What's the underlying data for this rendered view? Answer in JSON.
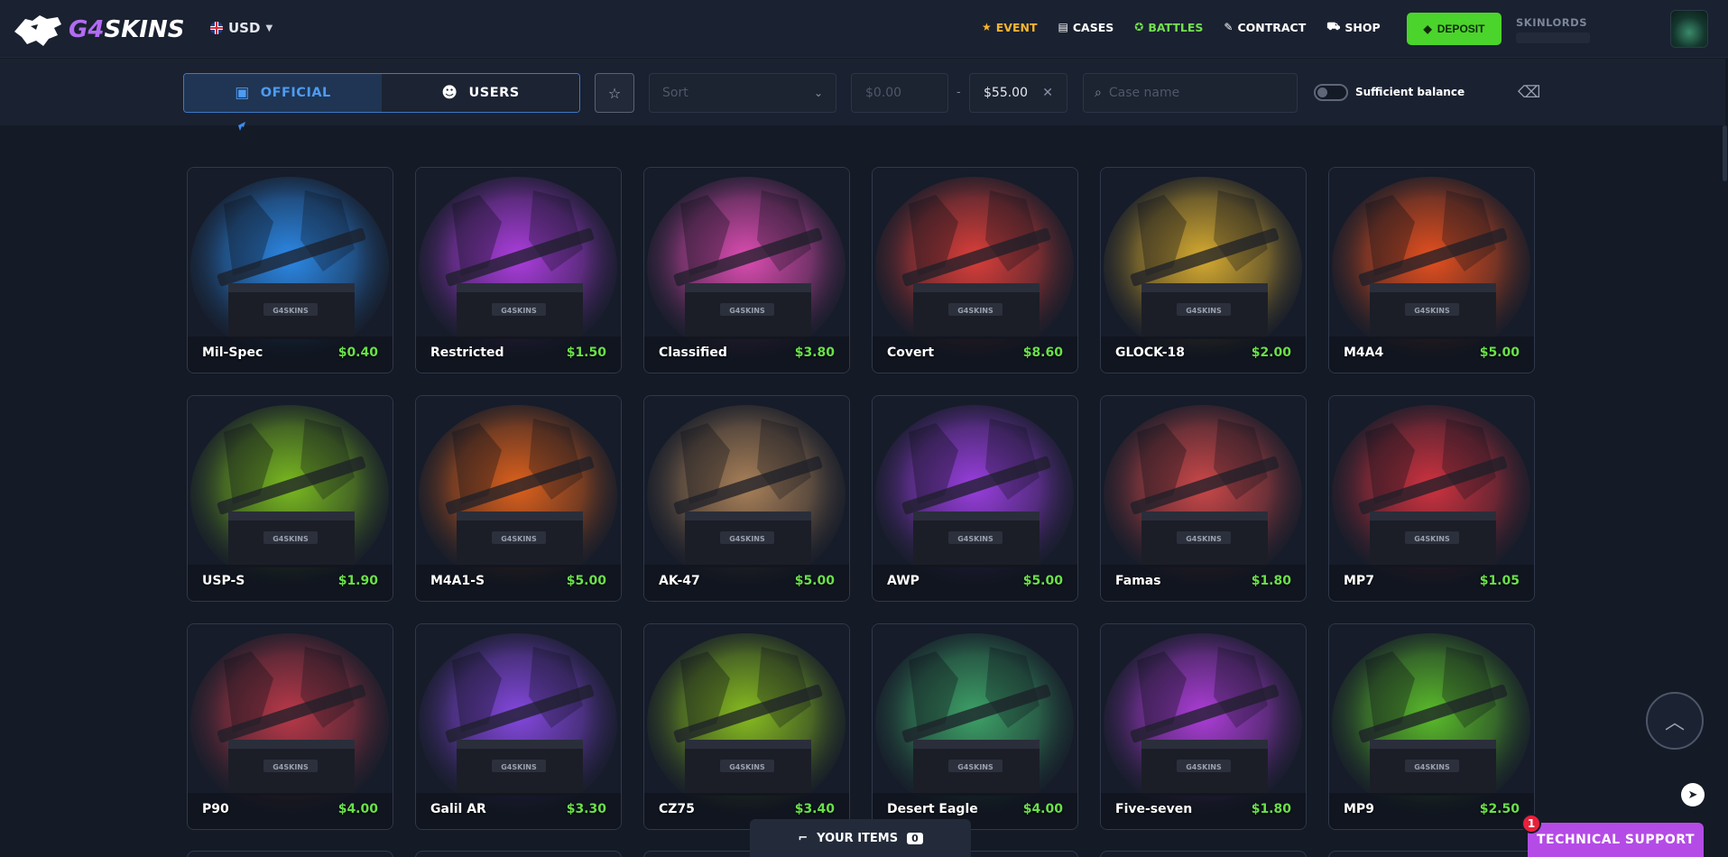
{
  "header": {
    "logo_text_prefix": "G4",
    "logo_text_suffix": "SKINS",
    "currency": "USD",
    "nav": [
      {
        "label": "EVENT",
        "icon": "star-icon",
        "color": "#f5b530"
      },
      {
        "label": "CASES",
        "icon": "cases-icon",
        "color": "#ffffff"
      },
      {
        "label": "BATTLES",
        "icon": "battles-icon",
        "color": "#72e04f"
      },
      {
        "label": "CONTRACT",
        "icon": "pencil-icon",
        "color": "#ffffff"
      },
      {
        "label": "SHOP",
        "icon": "cart-icon",
        "color": "#ffffff"
      }
    ],
    "deposit_label": "DEPOSIT",
    "username": "SKINLORDS"
  },
  "filters": {
    "tabs": [
      {
        "label": "OFFICIAL",
        "icon": "store-icon",
        "active": true
      },
      {
        "label": "USERS",
        "icon": "users-icon",
        "active": false
      }
    ],
    "sort_placeholder": "Sort",
    "price_from_placeholder": "$0.00",
    "price_to_value": "$55.00",
    "case_name_placeholder": "Case name",
    "sufficient_balance_label": "Sufficient balance",
    "sufficient_balance_on": false
  },
  "cases": [
    {
      "name": "Mil-Spec",
      "price": "$0.40",
      "color": "#2d8ef0"
    },
    {
      "name": "Restricted",
      "price": "$1.50",
      "color": "#b43fe8"
    },
    {
      "name": "Classified",
      "price": "$3.80",
      "color": "#e64fb8"
    },
    {
      "name": "Covert",
      "price": "$8.60",
      "color": "#e5403a"
    },
    {
      "name": "GLOCK-18",
      "price": "$2.00",
      "color": "#e0b230"
    },
    {
      "name": "M4A4",
      "price": "$5.00",
      "color": "#f0521e"
    },
    {
      "name": "USP-S",
      "price": "$1.90",
      "color": "#7fc21f"
    },
    {
      "name": "M4A1-S",
      "price": "$5.00",
      "color": "#e8641b"
    },
    {
      "name": "AK-47",
      "price": "$5.00",
      "color": "#b0855a"
    },
    {
      "name": "AWP",
      "price": "$5.00",
      "color": "#a040e8"
    },
    {
      "name": "Famas",
      "price": "$1.80",
      "color": "#d44a4a"
    },
    {
      "name": "MP7",
      "price": "$1.05",
      "color": "#d83340"
    },
    {
      "name": "P90",
      "price": "$4.00",
      "color": "#c23a4a"
    },
    {
      "name": "Galil AR",
      "price": "$3.30",
      "color": "#8a4ae8"
    },
    {
      "name": "CZ75",
      "price": "$3.40",
      "color": "#8dc41f"
    },
    {
      "name": "Desert Eagle",
      "price": "$4.00",
      "color": "#3fa86a"
    },
    {
      "name": "Five-seven",
      "price": "$1.80",
      "color": "#b43fe0"
    },
    {
      "name": "MP9",
      "price": "$2.50",
      "color": "#5ec42a"
    }
  ],
  "floating": {
    "your_items_label": "YOUR ITEMS",
    "your_items_count": "0",
    "support_label": "TECHNICAL SUPPORT",
    "support_badge": "1"
  }
}
